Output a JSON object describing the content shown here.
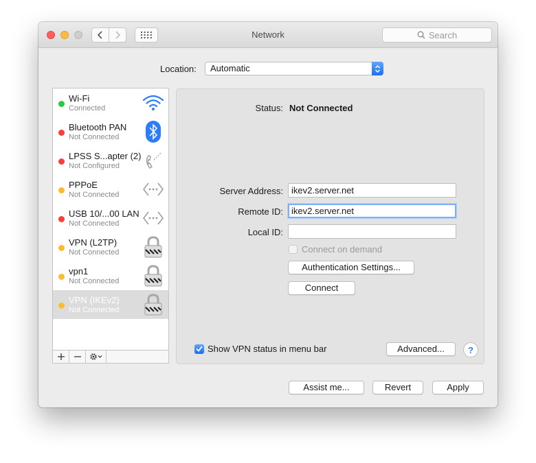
{
  "window": {
    "title": "Network"
  },
  "toolbar": {
    "search_placeholder": "Search"
  },
  "location": {
    "label": "Location:",
    "value": "Automatic"
  },
  "services": [
    {
      "name": "Wi-Fi",
      "status": "Connected",
      "dot_color": "#29c940",
      "icon": "wifi-icon"
    },
    {
      "name": "Bluetooth PAN",
      "status": "Not Connected",
      "dot_color": "#fc3d39",
      "icon": "bluetooth-icon"
    },
    {
      "name": "LPSS S...apter (2)",
      "status": "Not Configured",
      "dot_color": "#fc3d39",
      "icon": "phone-icon"
    },
    {
      "name": "PPPoE",
      "status": "Not Connected",
      "dot_color": "#fdbc2f",
      "icon": "ethernet-icon"
    },
    {
      "name": "USB 10/...00 LAN",
      "status": "Not Connected",
      "dot_color": "#fc3d39",
      "icon": "ethernet-icon"
    },
    {
      "name": "VPN (L2TP)",
      "status": "Not Connected",
      "dot_color": "#fdbc2f",
      "icon": "lock-icon"
    },
    {
      "name": "vpn1",
      "status": "Not Connected",
      "dot_color": "#fdbc2f",
      "icon": "lock-icon"
    },
    {
      "name": "VPN (IKEv2)",
      "status": "Not Connected",
      "dot_color": "#fdbc2f",
      "icon": "lock-icon",
      "selected": true
    }
  ],
  "detail": {
    "status_label": "Status:",
    "status_value": "Not Connected",
    "server_address_label": "Server Address:",
    "server_address_value": "ikev2.server.net",
    "remote_id_label": "Remote ID:",
    "remote_id_value": "ikev2.server.net",
    "local_id_label": "Local ID:",
    "local_id_value": "",
    "connect_on_demand_label": "Connect on demand",
    "auth_settings_label": "Authentication Settings...",
    "connect_label": "Connect",
    "show_vpn_label": "Show VPN status in menu bar",
    "advanced_label": "Advanced...",
    "help_label": "?"
  },
  "footer": {
    "assist_label": "Assist me...",
    "revert_label": "Revert",
    "apply_label": "Apply"
  },
  "colors": {
    "accent": "#2e7cf6",
    "selection": "#dcdcdc"
  }
}
